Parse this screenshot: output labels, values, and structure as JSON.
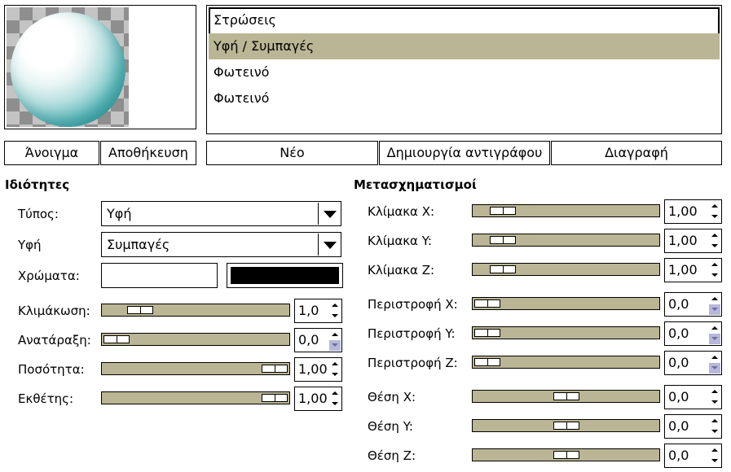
{
  "preview": {
    "alt": ""
  },
  "layers": {
    "items": [
      {
        "label": "Στρώσεις"
      },
      {
        "label": "Υφή / Συμπαγές"
      },
      {
        "label": "Φωτεινό"
      },
      {
        "label": "Φωτεινό"
      }
    ],
    "focused_index": 0,
    "selected_index": 1
  },
  "buttons": {
    "open": "Άνοιγμα",
    "save": "Αποθήκευση",
    "new": "Νέο",
    "duplicate": "Δημιουργία αντιγράφου",
    "delete": "Διαγραφή"
  },
  "properties": {
    "header": "Ιδιότητες",
    "type_label": "Τύπος:",
    "type_value": "Υφή",
    "texture_label": "Υφή",
    "texture_value": "Συμπαγές",
    "colors_label": "Χρώματα:",
    "color1": "#ffffff",
    "color2": "#000000",
    "scale": {
      "label": "Κλιμάκωση:",
      "value": "1,0",
      "fraction": 0.15
    },
    "turbulence": {
      "label": "Ανατάραξη:",
      "value": "0,0",
      "fraction": 0.0
    },
    "amount": {
      "label": "Ποσότητα:",
      "value": "1,00",
      "fraction": 1.0
    },
    "exponent": {
      "label": "Εκθέτης:",
      "value": "1,00",
      "fraction": 1.0
    }
  },
  "transforms": {
    "header": "Μετασχηματισμοί",
    "rows": [
      {
        "label": "Κλίμακα X:",
        "value": "1,00",
        "fraction": 0.1,
        "min": false
      },
      {
        "label": "Κλίμακα Y:",
        "value": "1,00",
        "fraction": 0.1,
        "min": false
      },
      {
        "label": "Κλίμακα Z:",
        "value": "1,00",
        "fraction": 0.1,
        "min": false
      },
      {
        "label": "Περιστροφή X:",
        "value": "0,0",
        "fraction": 0.0,
        "min": true
      },
      {
        "label": "Περιστροφή Y:",
        "value": "0,0",
        "fraction": 0.0,
        "min": true
      },
      {
        "label": "Περιστροφή Z:",
        "value": "0,0",
        "fraction": 0.0,
        "min": true
      },
      {
        "label": "Θέση X:",
        "value": "0,0",
        "fraction": 0.5,
        "min": false
      },
      {
        "label": "Θέση Y:",
        "value": "0,0",
        "fraction": 0.5,
        "min": false
      },
      {
        "label": "Θέση Z:",
        "value": "0,0",
        "fraction": 0.5,
        "min": false
      }
    ]
  }
}
